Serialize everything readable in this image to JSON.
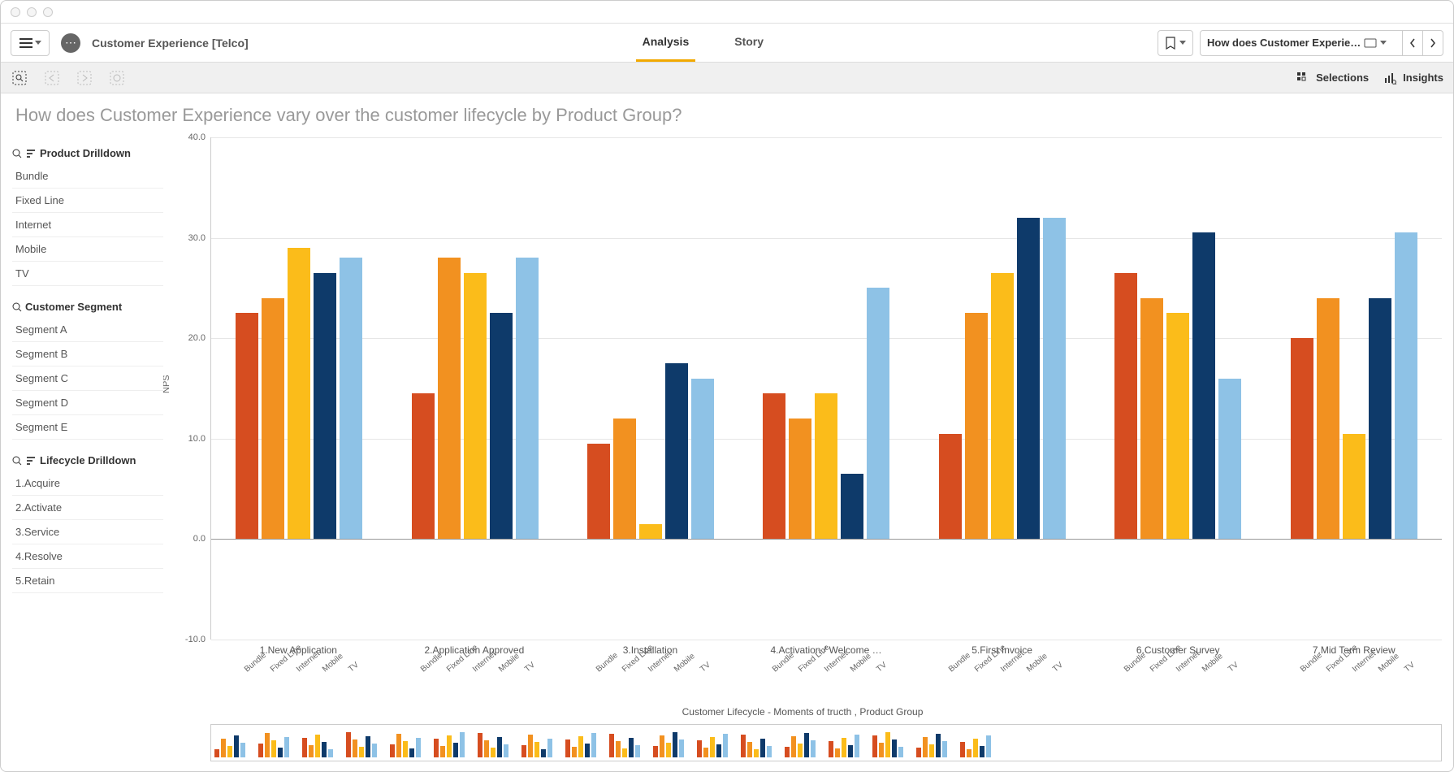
{
  "app_title": "Customer Experience [Telco]",
  "tabs": {
    "analysis": "Analysis",
    "story": "Story",
    "active": "analysis"
  },
  "sheet_selector": "How does Customer Experie…",
  "toolbar": {
    "selections": "Selections",
    "insights": "Insights"
  },
  "page_title": "How does Customer Experience vary over the customer lifecycle by Product Group?",
  "filters": {
    "product": {
      "title": "Product Drilldown",
      "items": [
        "Bundle",
        "Fixed Line",
        "Internet",
        "Mobile",
        "TV"
      ]
    },
    "segment": {
      "title": "Customer Segment",
      "items": [
        "Segment A",
        "Segment B",
        "Segment C",
        "Segment D",
        "Segment E"
      ]
    },
    "lifecycle": {
      "title": "Lifecycle Drilldown",
      "items": [
        "1.Acquire",
        "2.Activate",
        "3.Service",
        "4.Resolve",
        "5.Retain"
      ]
    }
  },
  "chart_data": {
    "type": "bar",
    "ylabel": "NPS",
    "xlabel": "Customer Lifecycle - Moments of tructh ,  Product Group",
    "ylim": [
      -10,
      40
    ],
    "yticks": [
      -10.0,
      0.0,
      10.0,
      20.0,
      30.0,
      40.0
    ],
    "categories": [
      "1.New Application",
      "2.Application Approved",
      "3.Installation",
      "4.Activation / Welcome …",
      "5.First Invoice",
      "6.Customer Survey",
      "7.Mid Term Review"
    ],
    "sub_categories": [
      "Bundle",
      "Fixed Line",
      "Internet",
      "Mobile",
      "TV"
    ],
    "colors": {
      "Bundle": "#d64d20",
      "Fixed Line": "#f29120",
      "Internet": "#fbbc1a",
      "Mobile": "#0e3a6a",
      "TV": "#8ec2e6"
    },
    "series": [
      {
        "category": "1.New Application",
        "values": {
          "Bundle": 22.5,
          "Fixed Line": 24,
          "Internet": 29,
          "Mobile": 26.5,
          "TV": 28
        }
      },
      {
        "category": "2.Application Approved",
        "values": {
          "Bundle": 14.5,
          "Fixed Line": 28,
          "Internet": 26.5,
          "Mobile": 22.5,
          "TV": 28
        }
      },
      {
        "category": "3.Installation",
        "values": {
          "Bundle": 9.5,
          "Fixed Line": 12,
          "Internet": 1.5,
          "Mobile": 17.5,
          "TV": 16
        }
      },
      {
        "category": "4.Activation / Welcome …",
        "values": {
          "Bundle": 14.5,
          "Fixed Line": 12,
          "Internet": 14.5,
          "Mobile": 6.5,
          "TV": 25
        }
      },
      {
        "category": "5.First Invoice",
        "values": {
          "Bundle": 10.5,
          "Fixed Line": 22.5,
          "Internet": 26.5,
          "Mobile": 32,
          "TV": 32
        }
      },
      {
        "category": "6.Customer Survey",
        "values": {
          "Bundle": 26.5,
          "Fixed Line": 24,
          "Internet": 22.5,
          "Mobile": 30.5,
          "TV": 16
        }
      },
      {
        "category": "7.Mid Term Review",
        "values": {
          "Bundle": 20,
          "Fixed Line": 24,
          "Internet": 10.5,
          "Mobile": 24,
          "TV": 30.5
        }
      }
    ],
    "overview_groups": 18
  }
}
